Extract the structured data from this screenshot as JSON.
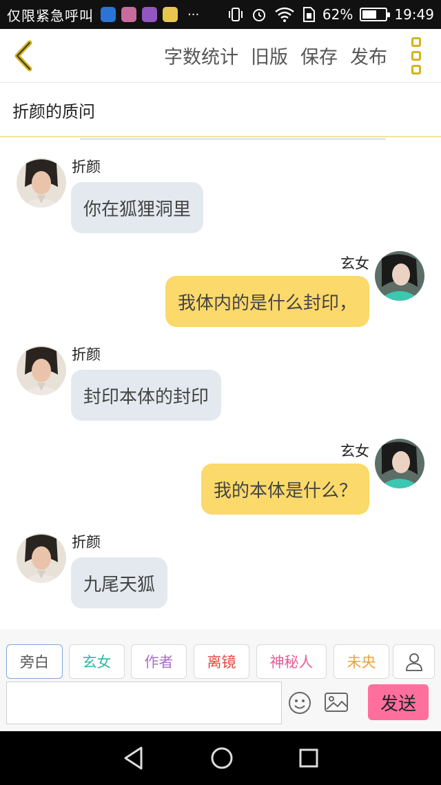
{
  "status_bar": {
    "carrier": "仅限紧急呼叫",
    "dots": "···",
    "battery_percent": "62%",
    "battery_level": 0.62,
    "time": "19:49"
  },
  "toolbar": {
    "actions": [
      "字数统计",
      "旧版",
      "保存",
      "发布"
    ]
  },
  "title": "折颜的质问",
  "messages": [
    {
      "side": "left",
      "name": "折颜",
      "text": "你在狐狸洞里"
    },
    {
      "side": "right",
      "name": "玄女",
      "text": "我体内的是什么封印，"
    },
    {
      "side": "left",
      "name": "折颜",
      "text": "封印本体的封印"
    },
    {
      "side": "right",
      "name": "玄女",
      "text": "我的本体是什么？"
    },
    {
      "side": "left",
      "name": "折颜",
      "text": "九尾天狐"
    }
  ],
  "roles": [
    {
      "label": "旁白",
      "color": "#555555"
    },
    {
      "label": "玄女",
      "color": "#2bb9a7"
    },
    {
      "label": "作者",
      "color": "#a870c6"
    },
    {
      "label": "离镜",
      "color": "#e0493a"
    },
    {
      "label": "神秘人",
      "color": "#e85b98"
    },
    {
      "label": "未央",
      "color": "#f0a23a"
    }
  ],
  "input": {
    "value": "",
    "placeholder": ""
  },
  "send_label": "发送",
  "colors": {
    "accent": "#d4b21c",
    "bubble_left": "#e3e9ef",
    "bubble_right": "#fbd96a",
    "send": "#ff6f9e"
  }
}
